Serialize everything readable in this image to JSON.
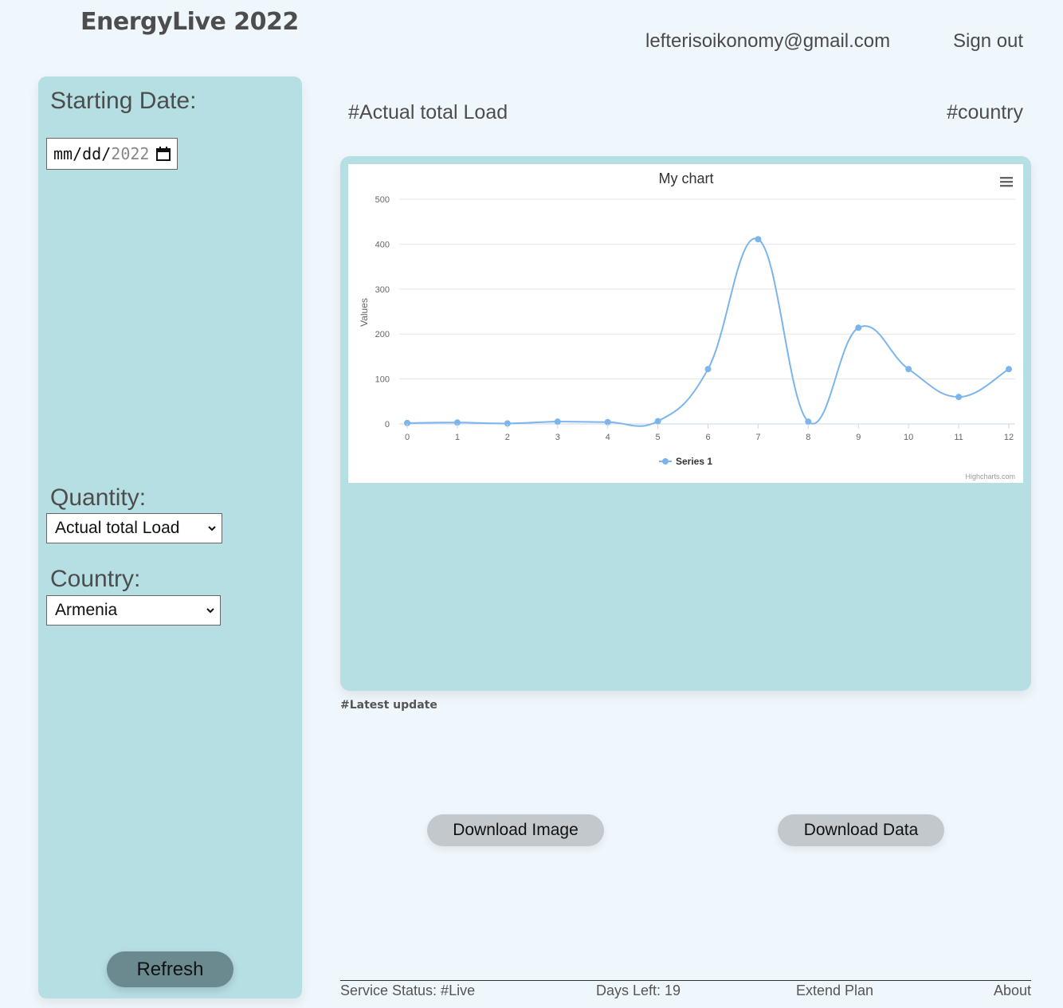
{
  "app": {
    "title": "EnergyLive 2022"
  },
  "user": {
    "email": "lefterisoikonomy@gmail.com",
    "signout_label": "Sign out"
  },
  "sidebar": {
    "start_date_label": "Starting Date:",
    "date_input": {
      "month_placeholder": "mm",
      "day_placeholder": "dd",
      "year": "2022",
      "sep": "/"
    },
    "quantity_label": "Quantity:",
    "quantity_selected": "Actual total Load",
    "country_label": "Country:",
    "country_selected": "Armenia",
    "refresh_label": "Refresh"
  },
  "main": {
    "quantity_heading": "#Actual total Load",
    "country_heading": "#country",
    "latest_update": "#Latest update",
    "download_image_label": "Download Image",
    "download_data_label": "Download Data"
  },
  "footer": {
    "status": "Service Status: #Live",
    "days_left": "Days Left: 19",
    "extend_plan": "Extend Plan",
    "about": "About"
  },
  "colors": {
    "background": "#f0f7fc",
    "panel": "#b6dfe4",
    "series": "#7cb5ec",
    "refresh_button": "#6a8a90",
    "download_button": "#c3c8cc"
  },
  "chart_data": {
    "type": "line",
    "title": "My chart",
    "ylabel": "Values",
    "xlabel": "",
    "x": [
      0,
      1,
      2,
      3,
      4,
      5,
      6,
      7,
      8,
      9,
      10,
      11,
      12
    ],
    "ylim": [
      0,
      500
    ],
    "yticks": [
      0,
      100,
      200,
      300,
      400,
      500
    ],
    "series": [
      {
        "name": "Series 1",
        "values": [
          2,
          3,
          1,
          5,
          4,
          6,
          122,
          411,
          5,
          214,
          122,
          60,
          122
        ]
      }
    ],
    "legend": "bottom-center",
    "credits": "Highcharts.com",
    "grid": true
  }
}
